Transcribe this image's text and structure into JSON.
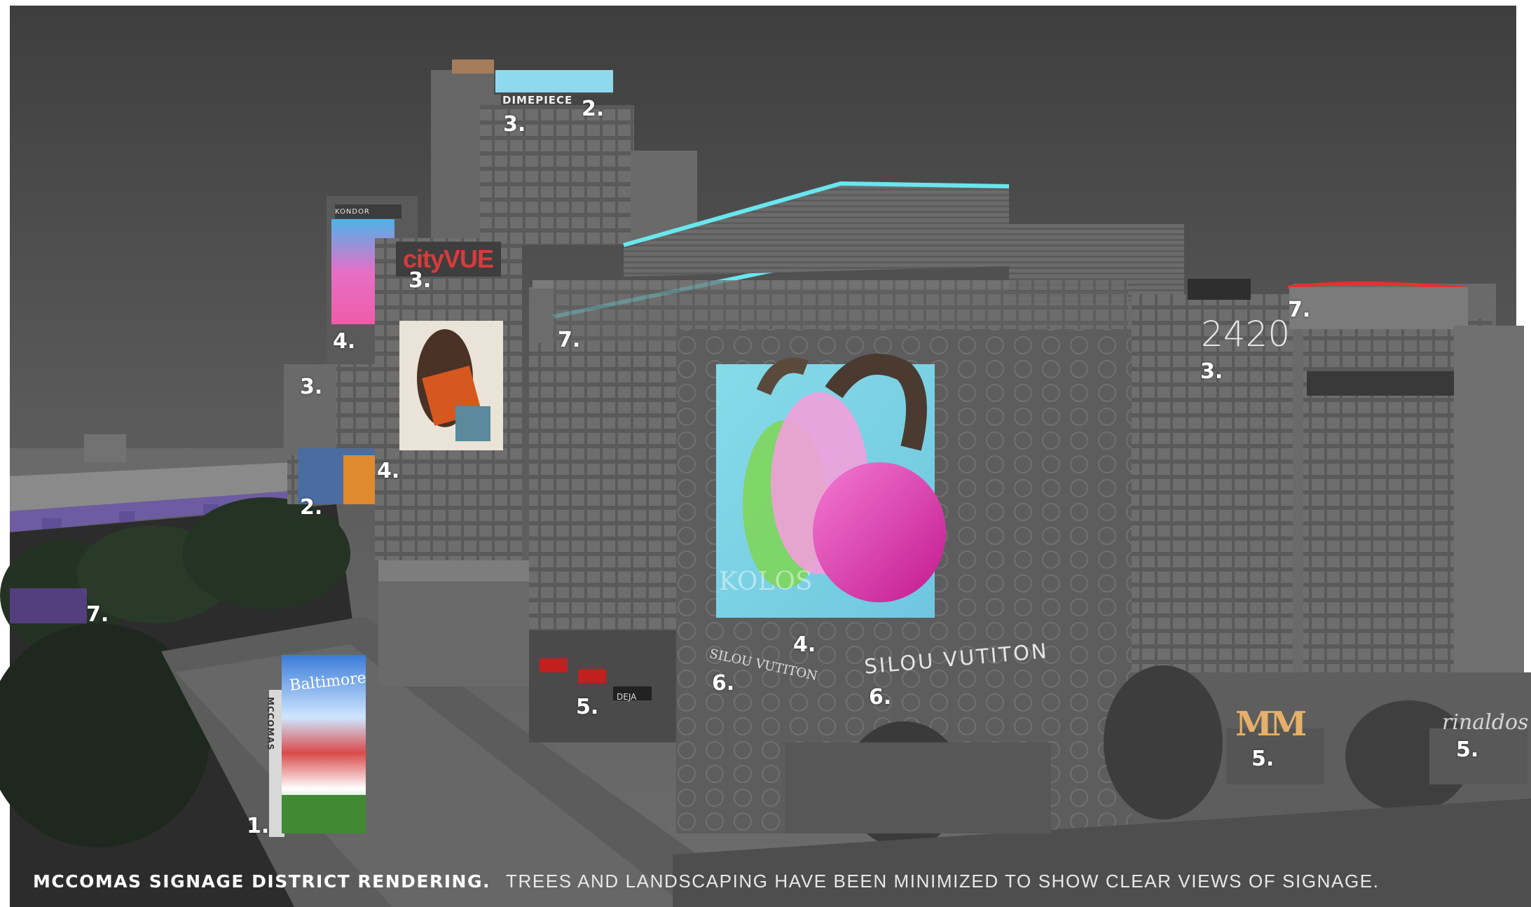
{
  "caption": {
    "title": "MCCOMAS SIGNAGE DISTRICT RENDERING.",
    "note": "TREES AND LANDSCAPING HAVE BEEN MINIMIZED TO SHOW CLEAR VIEWS OF SIGNAGE."
  },
  "signs": {
    "dimepiece": "DIMEPIECE",
    "kondor": "KONDOR",
    "cityvue": "cityVUE",
    "address": "2420",
    "silou_large": "SILOU VUTITON",
    "silou_small": "SILOU VUTITON",
    "mm": "MM",
    "rinaldos": "rinaldos",
    "baltimore": "Baltimore",
    "mccomas": "MCCOMAS",
    "kolos": "KOLOS",
    "storefront": "DEJA"
  },
  "markers": [
    "1.",
    "2.",
    "2.",
    "3.",
    "3.",
    "3.",
    "3.",
    "4.",
    "4.",
    "4.",
    "5.",
    "5.",
    "5.",
    "6.",
    "6.",
    "7.",
    "7.",
    "7."
  ],
  "colors": {
    "sky": "#4a4a4a",
    "neon_cyan": "#69e6ee",
    "neon_red": "#e0342f",
    "overpass_purple": "#7a3fc9",
    "mm_gold": "#e6b06a"
  }
}
